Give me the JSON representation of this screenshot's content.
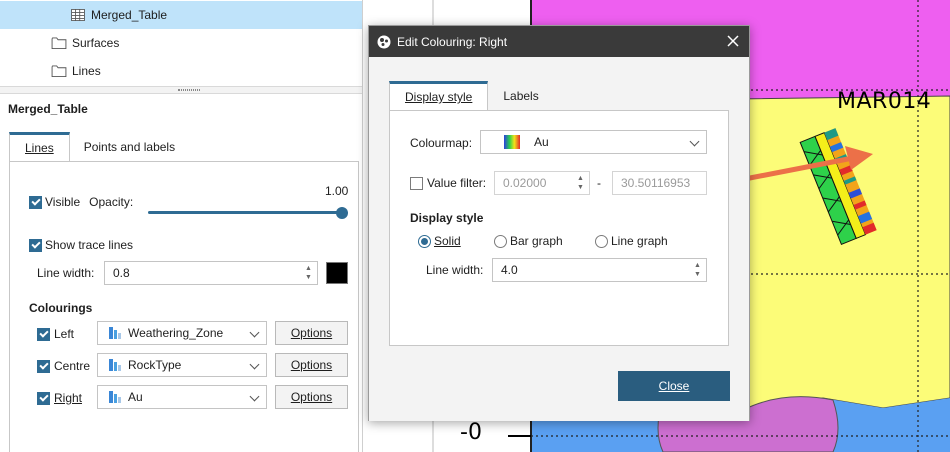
{
  "tree": {
    "items": [
      {
        "label": "Merged_Table",
        "icon": "table-icon",
        "selected": true
      },
      {
        "label": "Surfaces",
        "icon": "folder-icon"
      },
      {
        "label": "Lines",
        "icon": "folder-icon"
      }
    ]
  },
  "properties": {
    "title": "Merged_Table",
    "tabs": [
      {
        "label": "Lines",
        "active": true
      },
      {
        "label": "Points and labels",
        "active": false
      }
    ],
    "visible_label": "Visible",
    "opacity_label": "Opacity:",
    "opacity_value": "1.00",
    "opacity_fraction": 1.0,
    "trace_lines_label": "Show trace lines",
    "line_width_label": "Line width:",
    "line_width_value": "0.8",
    "line_colour": "#000000",
    "colourings_title": "Colourings",
    "colourings": [
      {
        "label": "Left",
        "value": "Weathering_Zone",
        "options": "Options",
        "icon": "categorical-colourmap-icon"
      },
      {
        "label": "Centre",
        "value": "RockType",
        "options": "Options",
        "icon": "categorical-colourmap-icon"
      },
      {
        "label": "Right",
        "value": "Au",
        "options": "Options",
        "icon": "numeric-colourmap-icon"
      }
    ]
  },
  "dialog": {
    "title": "Edit Colouring: Right",
    "tabs": [
      {
        "label": "Display style",
        "active": true
      },
      {
        "label": "Labels",
        "active": false
      }
    ],
    "colourmap_label": "Colourmap:",
    "colourmap_value": "Au",
    "value_filter_label": "Value filter:",
    "filter_min": "0.02000",
    "filter_separator": "-",
    "filter_max": "30.50116953",
    "display_style_title": "Display style",
    "styles": [
      {
        "label": "Solid",
        "checked": true
      },
      {
        "label": "Bar graph",
        "checked": false
      },
      {
        "label": "Line graph",
        "checked": false
      }
    ],
    "line_width_label": "Line width:",
    "line_width_value": "4.0",
    "close_label": "Close"
  },
  "viewport": {
    "hole_label": "MAR014",
    "elevation_label": "-0"
  },
  "colors": {
    "accent": "#2e6b93",
    "selection": "#bfe3fa",
    "magenta": "#ee5ff0",
    "yellow": "#fcfc78",
    "blue": "#5aa0f2",
    "purple": "#cc6fd0",
    "arrow": "#ec7048"
  }
}
